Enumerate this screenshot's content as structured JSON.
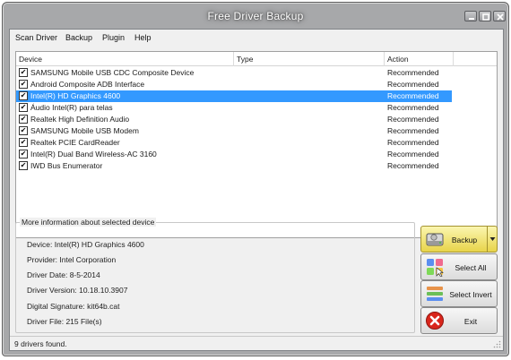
{
  "window": {
    "title": "Free Driver Backup"
  },
  "menu": [
    "Scan Driver",
    "Backup",
    "Plugin",
    "Help"
  ],
  "table": {
    "headers": [
      "Device",
      "Type",
      "Action"
    ],
    "rows": [
      {
        "device": "SAMSUNG Mobile USB CDC Composite Device",
        "type": "",
        "action": "Recommended",
        "checked": true,
        "selected": false
      },
      {
        "device": "Android Composite ADB Interface",
        "type": "",
        "action": "Recommended",
        "checked": true,
        "selected": false
      },
      {
        "device": "Intel(R) HD Graphics 4600",
        "type": "",
        "action": "Recommended",
        "checked": true,
        "selected": true
      },
      {
        "device": "Áudio Intel(R) para telas",
        "type": "",
        "action": "Recommended",
        "checked": true,
        "selected": false
      },
      {
        "device": "Realtek High Definition Audio",
        "type": "",
        "action": "Recommended",
        "checked": true,
        "selected": false
      },
      {
        "device": "SAMSUNG Mobile USB Modem",
        "type": "",
        "action": "Recommended",
        "checked": true,
        "selected": false
      },
      {
        "device": "Realtek PCIE CardReader",
        "type": "",
        "action": "Recommended",
        "checked": true,
        "selected": false
      },
      {
        "device": "Intel(R) Dual Band Wireless-AC 3160",
        "type": "",
        "action": "Recommended",
        "checked": true,
        "selected": false
      },
      {
        "device": "IWD Bus Enumerator",
        "type": "",
        "action": "Recommended",
        "checked": true,
        "selected": false
      }
    ]
  },
  "info": {
    "title": "More information about selected device",
    "lines": [
      "Device:  Intel(R) HD Graphics 4600",
      "Provider: Intel Corporation",
      "Driver Date: 8-5-2014",
      "Driver Version: 10.18.10.3907",
      "Digital Signature: kit64b.cat",
      "Driver File: 215 File(s)"
    ]
  },
  "buttons": {
    "backup": {
      "label": "Backup",
      "icon": "hard-drive-icon"
    },
    "select_all": {
      "label": "Select All",
      "icon": "select-all-icon"
    },
    "select_invert": {
      "label": "Select Invert",
      "icon": "select-invert-icon"
    },
    "exit": {
      "label": "Exit",
      "icon": "exit-icon"
    }
  },
  "status": {
    "text": "9 drivers found."
  },
  "colors": {
    "selection": "#3399ff",
    "backup_button": "#e8d44a",
    "exit_icon": "#d9261c"
  }
}
